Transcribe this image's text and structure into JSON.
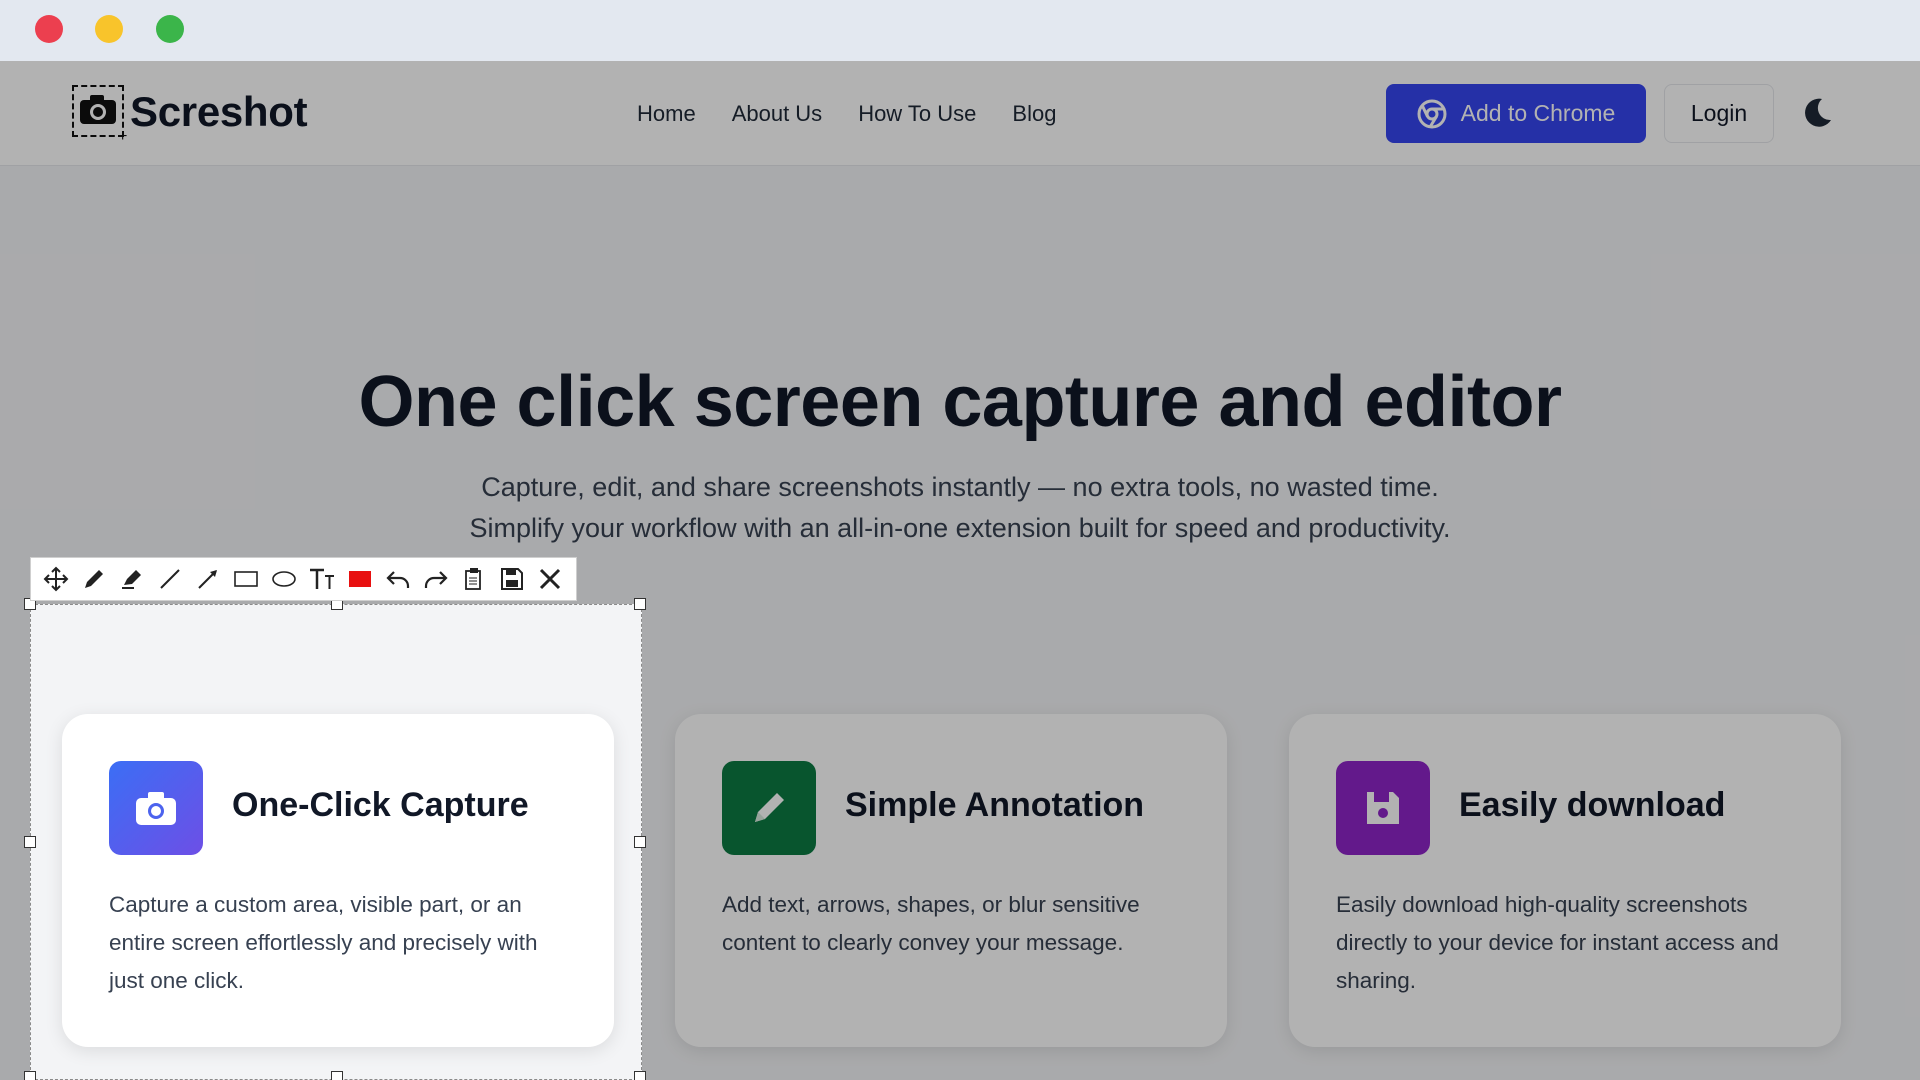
{
  "window": {
    "controls": [
      "close",
      "minimize",
      "maximize"
    ]
  },
  "header": {
    "logo_text": "Screshot",
    "nav": [
      "Home",
      "About Us",
      "How To Use",
      "Blog"
    ],
    "add_to_chrome_label": "Add to Chrome",
    "login_label": "Login",
    "theme_toggle_icon": "moon-icon"
  },
  "hero": {
    "title": "One click screen capture and editor",
    "subtitle": "Capture, edit, and share screenshots instantly — no extra tools, no wasted time. Simplify your workflow with an all-in-one extension built for speed and productivity."
  },
  "features": [
    {
      "title": "One-Click Capture",
      "description": "Capture a custom area, visible part, or an entire screen effortlessly and precisely with just one click.",
      "icon": "camera-icon",
      "color": "#3b6ef5"
    },
    {
      "title": "Simple Annotation",
      "description": "Add text, arrows, shapes, or blur sensitive content to clearly convey your message.",
      "icon": "pencil-icon",
      "color": "#0c7a43"
    },
    {
      "title": "Easily download",
      "description": "Easily download high-quality screenshots directly to your device for instant access and sharing.",
      "icon": "save-icon",
      "color": "#8e24c8"
    }
  ],
  "toolbar": {
    "tools": [
      "move-icon",
      "pencil-icon",
      "highlighter-icon",
      "line-icon",
      "arrow-icon",
      "rectangle-icon",
      "ellipse-icon",
      "text-icon",
      "color-swatch",
      "undo-icon",
      "redo-icon",
      "copy-icon",
      "save-icon",
      "close-icon"
    ],
    "current_color": "#e81010"
  },
  "colors": {
    "brand_button": "#3545ef",
    "overlay": "rgba(0,0,0,0.30)"
  }
}
